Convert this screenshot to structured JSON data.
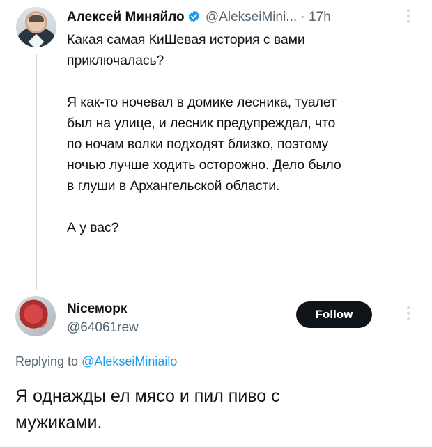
{
  "tweet": {
    "author_name": "Алексей Миняйло",
    "author_handle": "@AlekseiMini...",
    "separator": "·",
    "time": "17h",
    "text": "Какая самая КиШевая история с вами\nприключалась?\n\nЯ как-то ночевал в домике лесника, туалет\nбыл на улице, и лесник предупреждал, что\nпо ночам волки подходят близко, поэтому\nночью лучше ходить осторожно. Дело было\nв глуши в Архангельской области.\n\nА у вас?"
  },
  "reply": {
    "author_name": "Nісеморк",
    "author_handle": "@64061rew",
    "follow_label": "Follow",
    "replying_prefix": "Replying to",
    "replying_to": "@AlekseiMiniailo",
    "text": "Я однажды ел мясо и пил пиво с\nмужиками."
  },
  "colors": {
    "verified": "#1d9bf0",
    "secondary_text": "#536471",
    "follow_bg": "#0f1419"
  }
}
